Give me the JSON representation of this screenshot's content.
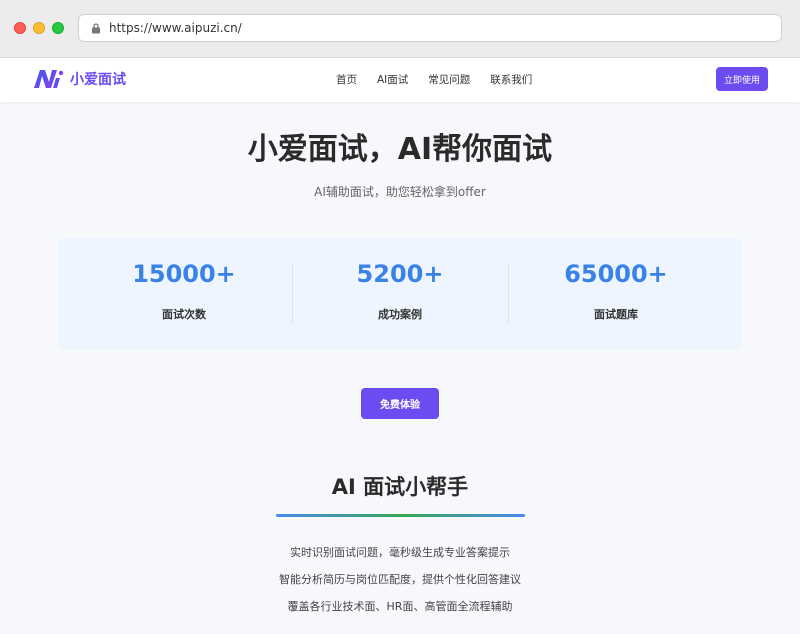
{
  "browser": {
    "url": "https://www.aipuzi.cn/"
  },
  "nav": {
    "brand": "小爱面试",
    "menu": [
      "首页",
      "AI面试",
      "常见问题",
      "联系我们"
    ],
    "cta": "立即使用"
  },
  "hero": {
    "title": "小爱面试，AI帮你面试",
    "subtitle": "AI辅助面试，助您轻松拿到offer"
  },
  "stats": [
    {
      "value": "15000+",
      "label": "面试次数"
    },
    {
      "value": "5200+",
      "label": "成功案例"
    },
    {
      "value": "65000+",
      "label": "面试题库"
    }
  ],
  "free_button": "免费体验",
  "section": {
    "title": "AI 面试小帮手",
    "features": [
      "实时识别面试问题，毫秒级生成专业答案提示",
      "智能分析简历与岗位匹配度，提供个性化回答建议",
      "覆盖各行业技术面、HR面、高管面全流程辅助"
    ]
  },
  "colors": {
    "accent": "#6c4cf1",
    "stat_number": "#3b82e8"
  }
}
